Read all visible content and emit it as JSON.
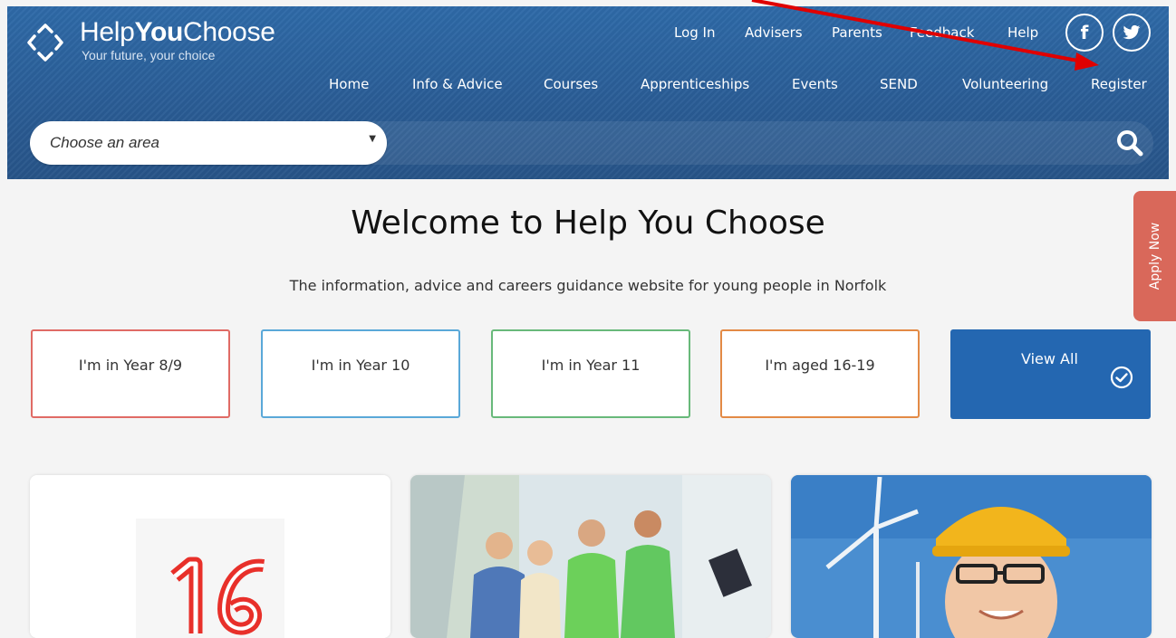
{
  "brand": {
    "name_part1": "Help",
    "name_part2": "You",
    "name_part3": "Choose",
    "tagline": "Your future, your choice"
  },
  "top_links": [
    "Log In",
    "Advisers",
    "Parents",
    "Feedback",
    "Help"
  ],
  "social": {
    "facebook": "f",
    "twitter_icon": "twitter-icon"
  },
  "main_nav": [
    "Home",
    "Info & Advice",
    "Courses",
    "Apprenticeships",
    "Events",
    "SEND",
    "Volunteering",
    "Register"
  ],
  "search": {
    "area_placeholder": "Choose an area"
  },
  "apply_tab": "Apply Now",
  "hero": {
    "title": "Welcome to Help You Choose",
    "subtitle": "The information, advice and careers guidance website for young people in Norfolk"
  },
  "year_cards": [
    {
      "label": "I'm in Year 8/9",
      "color": "#e06b65"
    },
    {
      "label": "I'm in Year 10",
      "color": "#5aa8d8"
    },
    {
      "label": "I'm in Year 11",
      "color": "#68b97a"
    },
    {
      "label": "I'm aged 16-19",
      "color": "#e38a45"
    }
  ],
  "view_all": {
    "label": "View All",
    "color": "#2467b1"
  },
  "colors": {
    "header": "#2a5d96",
    "apply": "#d9685a",
    "annotation_arrow": "#e00000"
  }
}
